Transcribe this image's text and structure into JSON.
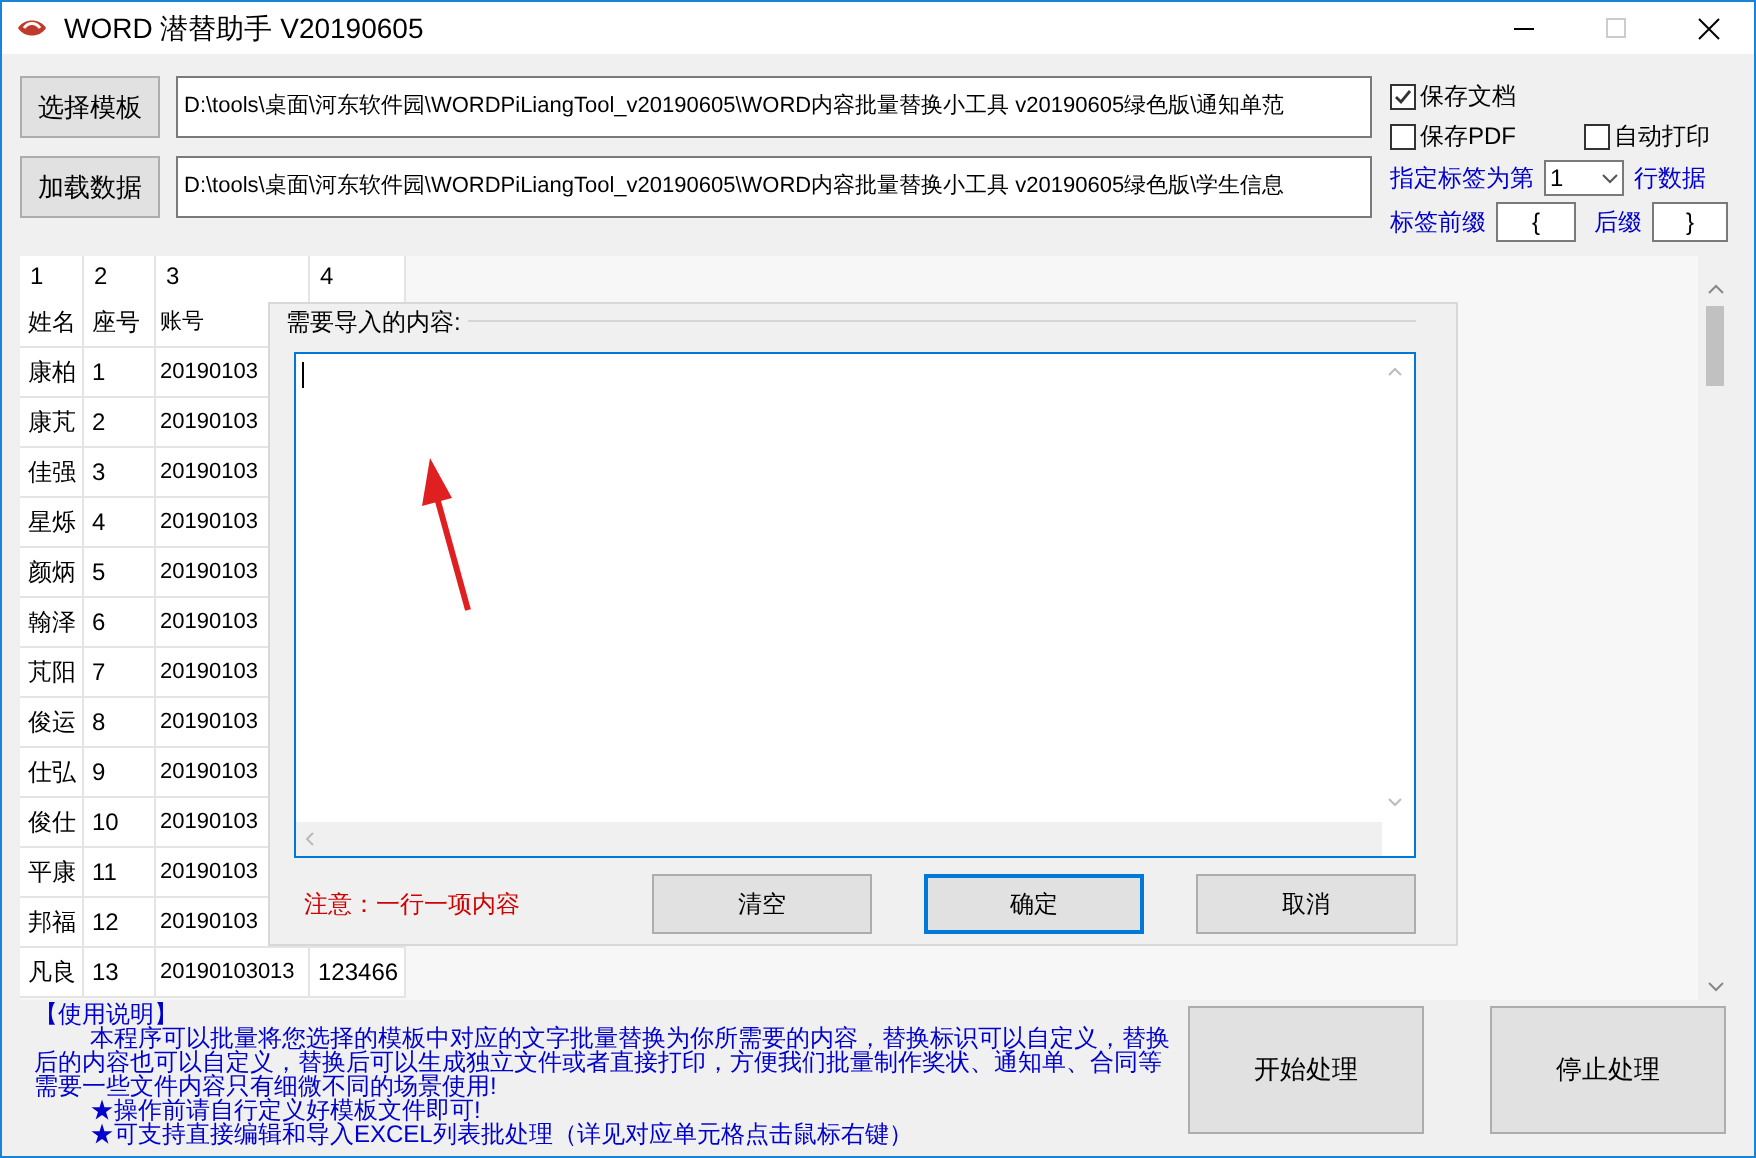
{
  "window": {
    "title": "WORD 潜替助手 V20190605"
  },
  "template_button": "选择模板",
  "template_path": "D:\\tools\\桌面\\河东软件园\\WORDPiLiangTool_v20190605\\WORD内容批量替换小工具 v20190605绿色版\\通知单范",
  "data_button": "加载数据",
  "data_path": "D:\\tools\\桌面\\河东软件园\\WORDPiLiangTool_v20190605\\WORD内容批量替换小工具 v20190605绿色版\\学生信息",
  "options": [
    {
      "label": "保存文档",
      "checked": true
    },
    {
      "label": "保存PDF",
      "checked": false
    },
    {
      "label": "自动打印",
      "checked": false
    }
  ],
  "label_row": {
    "prefix_text": "指定标签为第",
    "value": "1",
    "suffix_text": "行数据"
  },
  "tag": {
    "prefix_label": "标签前缀",
    "prefix_value": "{",
    "suffix_label": "后缀",
    "suffix_value": "}"
  },
  "table": {
    "column_numbers": [
      "1",
      "2",
      "3",
      "4"
    ],
    "rows": [
      [
        "姓名",
        "座号",
        "账号"
      ],
      [
        "康柏",
        "1",
        "20190103"
      ],
      [
        "康芃",
        "2",
        "20190103"
      ],
      [
        "佳强",
        "3",
        "20190103"
      ],
      [
        "星烁",
        "4",
        "20190103"
      ],
      [
        "颜炳",
        "5",
        "20190103"
      ],
      [
        "翰泽",
        "6",
        "20190103"
      ],
      [
        "芃阳",
        "7",
        "20190103"
      ],
      [
        "俊运",
        "8",
        "20190103"
      ],
      [
        "仕弘",
        "9",
        "20190103"
      ],
      [
        "俊仕",
        "10",
        "20190103"
      ],
      [
        "平康",
        "11",
        "20190103"
      ],
      [
        "邦福",
        "12",
        "20190103"
      ],
      [
        "凡良",
        "13",
        "20190103013",
        "123466"
      ]
    ]
  },
  "dialog": {
    "title": "需要导入的内容:",
    "note": "注意：一行一项内容",
    "buttons": [
      {
        "label": "清空",
        "focused": false
      },
      {
        "label": "确定",
        "focused": true
      },
      {
        "label": "取消",
        "focused": false
      }
    ]
  },
  "instructions": {
    "title": "【使用说明】",
    "paragraph": "本程序可以批量将您选择的模板中对应的文字批量替换为你所需要的内容，替换标识可以自定义，替换后的内容也可以自定义，替换后可以生成独立文件或者直接打印，方便我们批量制作奖状、通知单、合同等需要一些文件内容只有细微不同的场景使用!",
    "bullets": [
      "★操作前请自行定义好模板文件即可!",
      "★可支持直接编辑和导入EXCEL列表批处理（详见对应单元格点击鼠标右键）"
    ]
  },
  "actions": [
    "开始处理",
    "停止处理"
  ]
}
